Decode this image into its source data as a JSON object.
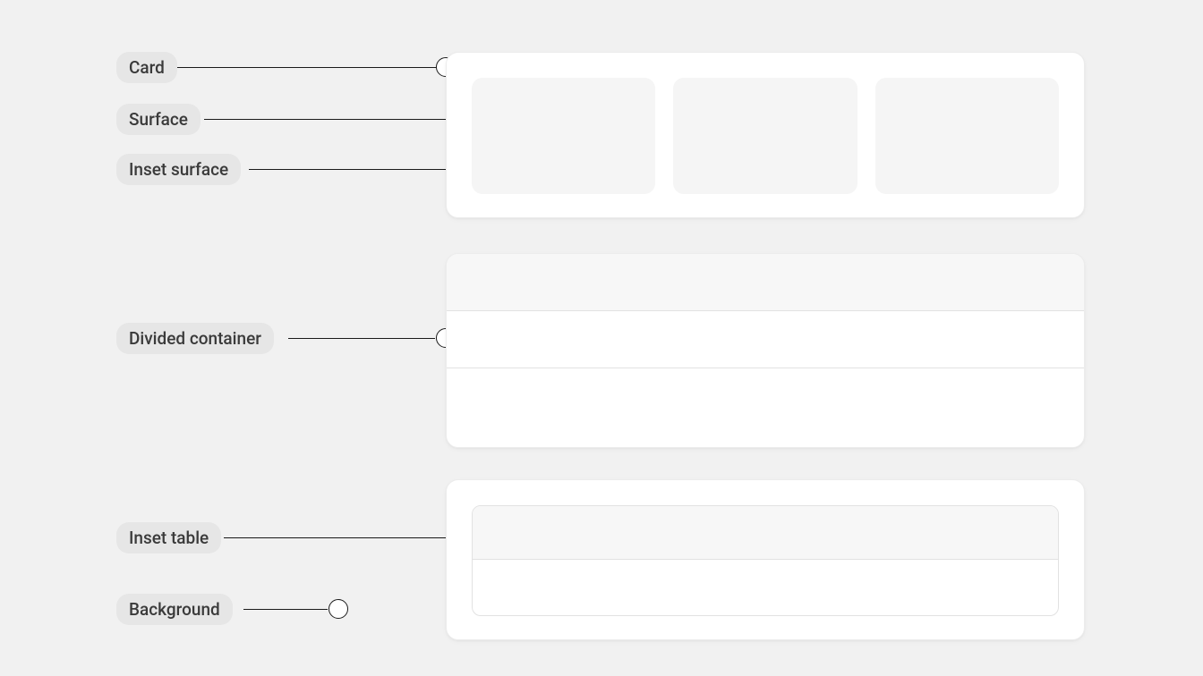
{
  "labels": {
    "card": "Card",
    "surface": "Surface",
    "inset_surface": "Inset surface",
    "divided_container": "Divided container",
    "inset_table": "Inset table",
    "background": "Background"
  },
  "diagram": {
    "panels": [
      {
        "id": "card-surface-inset",
        "inset_cells": 3
      },
      {
        "id": "divided-container",
        "rows": 3
      },
      {
        "id": "inset-table",
        "rows": 2
      }
    ],
    "annotations": [
      {
        "label_key": "card",
        "target": "card-panel-edge"
      },
      {
        "label_key": "surface",
        "target": "surface-area"
      },
      {
        "label_key": "inset_surface",
        "target": "first-inset-cell"
      },
      {
        "label_key": "divided_container",
        "target": "divided-panel-edge"
      },
      {
        "label_key": "inset_table",
        "target": "inset-table-cell"
      },
      {
        "label_key": "background",
        "target": "page-background"
      }
    ]
  },
  "colors": {
    "page_bg": "#f1f1f1",
    "card_bg": "#ffffff",
    "inset_bg": "#f5f5f5",
    "divider": "#e2e2e2",
    "label_bg": "#e6e6e6",
    "label_text": "#3a3a3a"
  }
}
